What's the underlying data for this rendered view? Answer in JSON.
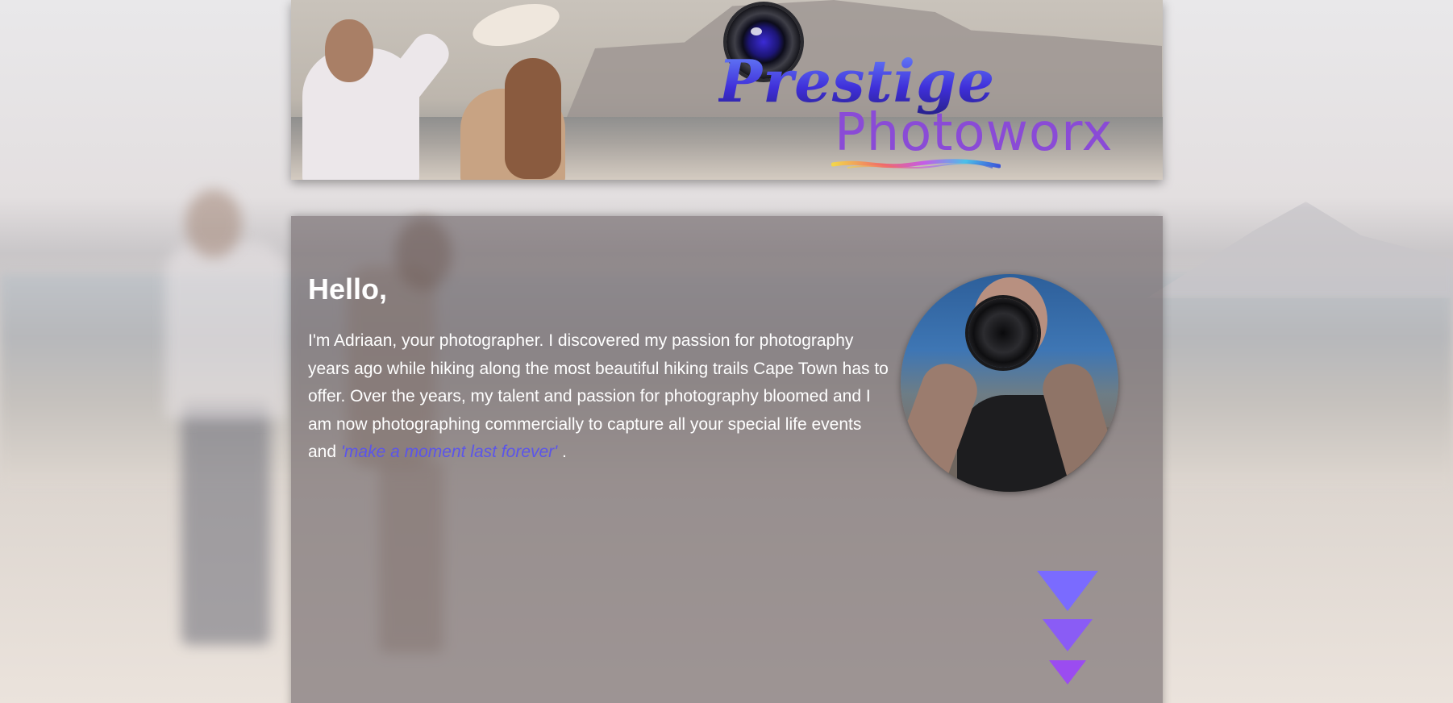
{
  "header": {
    "logo_text_line1": "Prestige",
    "logo_text_line2": "Photoworx",
    "banner_image_alt": "Couple on the beach"
  },
  "intro": {
    "greeting": "Hello,",
    "body_text": "I'm Adriaan, your photographer. I discovered my passion for photography years ago while hiking along the most beautiful hiking trails Cape Town has to offer. Over the years, my talent and passion for photography bloomed and I am now photographing commercially to capture all your special life events and",
    "tagline": "'make a moment last forever'",
    "ending": " ."
  },
  "portrait": {
    "icon": "photographer-portrait"
  },
  "scroll": {
    "icon": "scroll-down-arrows-icon"
  },
  "colors": {
    "accent": "#5b55ea",
    "arrow_top": "#7a6bff",
    "arrow_mid": "#8a5cf5",
    "arrow_bottom": "#9b4cf0",
    "card_bg": "rgba(110,100,104,0.62)"
  }
}
